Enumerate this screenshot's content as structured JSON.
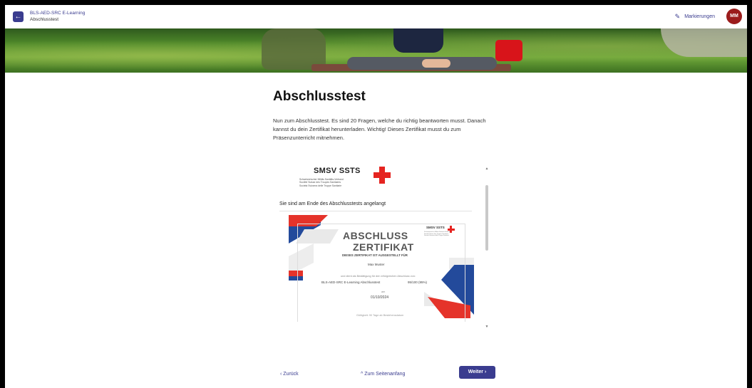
{
  "header": {
    "course_title": "BLS-AED-SRC E-Learning",
    "course_subtitle": "Abschlusstest",
    "back_icon": "arrow-left-icon",
    "marks_label": "Markierungen",
    "marks_icon": "pen-icon",
    "avatar_initials": "MM"
  },
  "main": {
    "title": "Abschlusstest",
    "intro": "Nun zum Abschlusstest. Es sind 20 Fragen, welche du richtig beantworten musst. Danach kannst du dein Zertifikat herunterladen. Wichtig! Dieses Zertifikat musst du zum Präsenzunterricht mitnehmen."
  },
  "viewer": {
    "org_name": "SMSV SSTS",
    "org_lines": [
      "Schweizerischer Militär-Sanitäts-Verband",
      "Société Suisse des Troupes Sanitaires",
      "Società Svizzera delle Truppe Sanitarie"
    ],
    "end_text": "Sie sind am Ende des Abschlusstests angelangt",
    "certificate": {
      "title_line1": "ABSCHLUSS",
      "title_line2": "ZERTIFIKAT",
      "subtitle": "DIESES ZERTIFIKAT IST AUSGESTELLT FÜR",
      "logo_name": "SMSV SSTS",
      "recipient": "Max Muster",
      "confirmation": "und dient als Bestätigung für den erfolgreichen Abschluss von:",
      "course": "BLS-AED-SRC E-Learning Abschlusstest",
      "score": "95/100 (95%)",
      "am_label": "am",
      "date": "01/10/2024",
      "validity": "Gültigkeit: 90 Tage ab Bestehensdatum"
    }
  },
  "footer": {
    "back_label": "‹  Zurück",
    "top_label": "^  Zum Seitenanfang",
    "next_label": "Weiter  ›"
  },
  "colors": {
    "accent": "#3a3c8f",
    "avatar": "#9b1c1c",
    "cross": "#e52420"
  }
}
